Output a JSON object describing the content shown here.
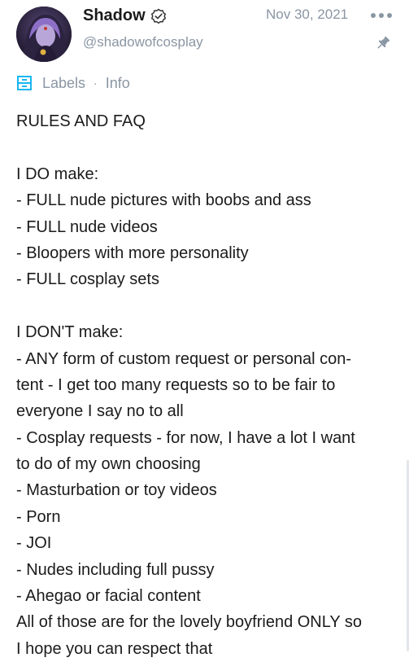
{
  "author": {
    "name": "Shadow",
    "handle": "@shadowofcosplay",
    "avatar_icon": "avatar-photo",
    "verified_icon": "verified-badge-icon"
  },
  "post": {
    "date": "Nov 30, 2021",
    "more_icon": "more-dots-icon",
    "pinned_icon": "pin-icon",
    "labels_icon": "labels-icon",
    "labels_link": "Labels",
    "separator": "·",
    "info_link": "Info",
    "body_lines": [
      "RULES AND FAQ",
      "",
      "I DO make:",
      "- FULL nude pictures with boobs and ass",
      "- FULL nude videos",
      "- Bloopers with more personality",
      "- FULL cosplay sets",
      "",
      "I DON'T make:",
      "- ANY form of custom request or personal con-",
      "tent - I get too many requests so to be fair to",
      "everyone I say no to all",
      "- Cosplay requests - for now, I have a lot I want",
      "to do of my own choosing",
      "- Masturbation or toy videos",
      "- Porn",
      "- JOI",
      "- Nudes including full pussy",
      "- Ahegao or facial content",
      "All of those are for the lovely boyfriend ONLY so",
      "I hope you can respect that"
    ]
  },
  "colors": {
    "muted_text": "#8a96a3",
    "body_text": "#1b1b1b",
    "background": "#ffffff"
  }
}
